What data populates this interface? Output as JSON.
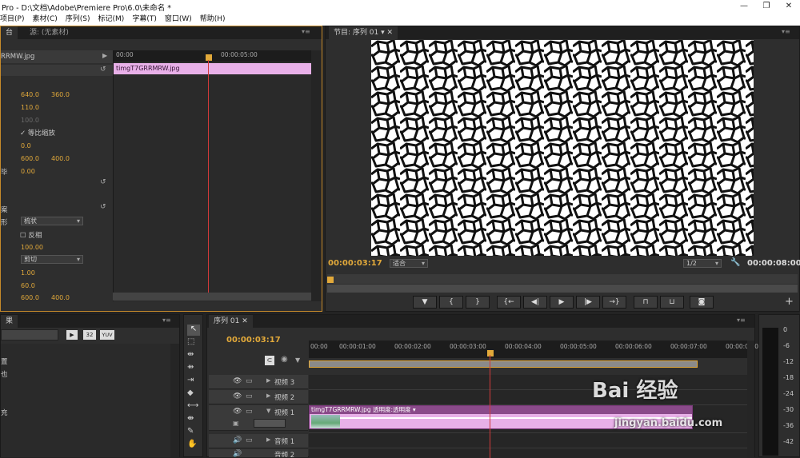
{
  "window": {
    "title": "Pro - D:\\文档\\Adobe\\Premiere Pro\\6.0\\未命名 *"
  },
  "menu": [
    "项目(P)",
    "素材(C)",
    "序列(S)",
    "标记(M)",
    "字幕(T)",
    "窗口(W)",
    "帮助(H)"
  ],
  "effect_controls": {
    "tab_active": "台",
    "tab_source": "源: (无素材)",
    "clip_name": "RRMW.jpg",
    "ruler_start": "00:00",
    "ruler_mid": "00:00:05:00",
    "timeline_clip": "timgT7GRRMRW.jpg",
    "position_x": "640.0",
    "position_y": "360.0",
    "scale": "110.0",
    "scale_width": "100.0",
    "uniform_scale": "等比缩放",
    "rotation": "0.0",
    "anchor_x": "600.0",
    "anchor_y": "400.0",
    "anti_flicker": "0.00",
    "section_label": "案",
    "shape_label": "形",
    "shape_value": "梳状",
    "reverse": "反相",
    "opacity": "100.00",
    "blend_value": "剪切",
    "v1": "1.00",
    "v2": "60.0",
    "v3_x": "600.0",
    "v3_y": "400.0",
    "stray_label": "毕"
  },
  "program_monitor": {
    "tab": "节目: 序列 01",
    "timecode": "00:00:03:17",
    "fit": "适合",
    "resolution": "1/2",
    "duration": "00:00:08:00"
  },
  "effects_panel": {
    "tab": "果",
    "items": [
      "置",
      "也",
      "充"
    ],
    "icon_labels": [
      "32",
      "YUV"
    ]
  },
  "sequence": {
    "tab": "序列 01",
    "timecode": "00:00:03:17",
    "ruler": [
      "00:00",
      "00:00:01:00",
      "00:00:02:00",
      "00:00:03:00",
      "00:00:04:00",
      "00:00:05:00",
      "00:00:06:00",
      "00:00:07:00",
      "00:00:08:00",
      "00:00"
    ],
    "tracks": {
      "v3": "视频 3",
      "v2": "视频 2",
      "v1": "视频 1",
      "a1": "音频 1",
      "a2": "音频 2"
    },
    "clip_label": "timgT7GRRMRW.jpg  透明度:透明度 ▾"
  },
  "audio_meter": {
    "scale": [
      "0",
      "-6",
      "-12",
      "-18",
      "-24",
      "-30",
      "-36",
      "-42"
    ]
  },
  "watermark": {
    "logo": "Bai 经验",
    "url": "jingyan.baidu.com"
  },
  "colors": {
    "accent": "#e2a93a",
    "playhead": "#d23a3a",
    "clip_pink": "#e8b0e8",
    "clip_purple": "#8a4a8a"
  }
}
